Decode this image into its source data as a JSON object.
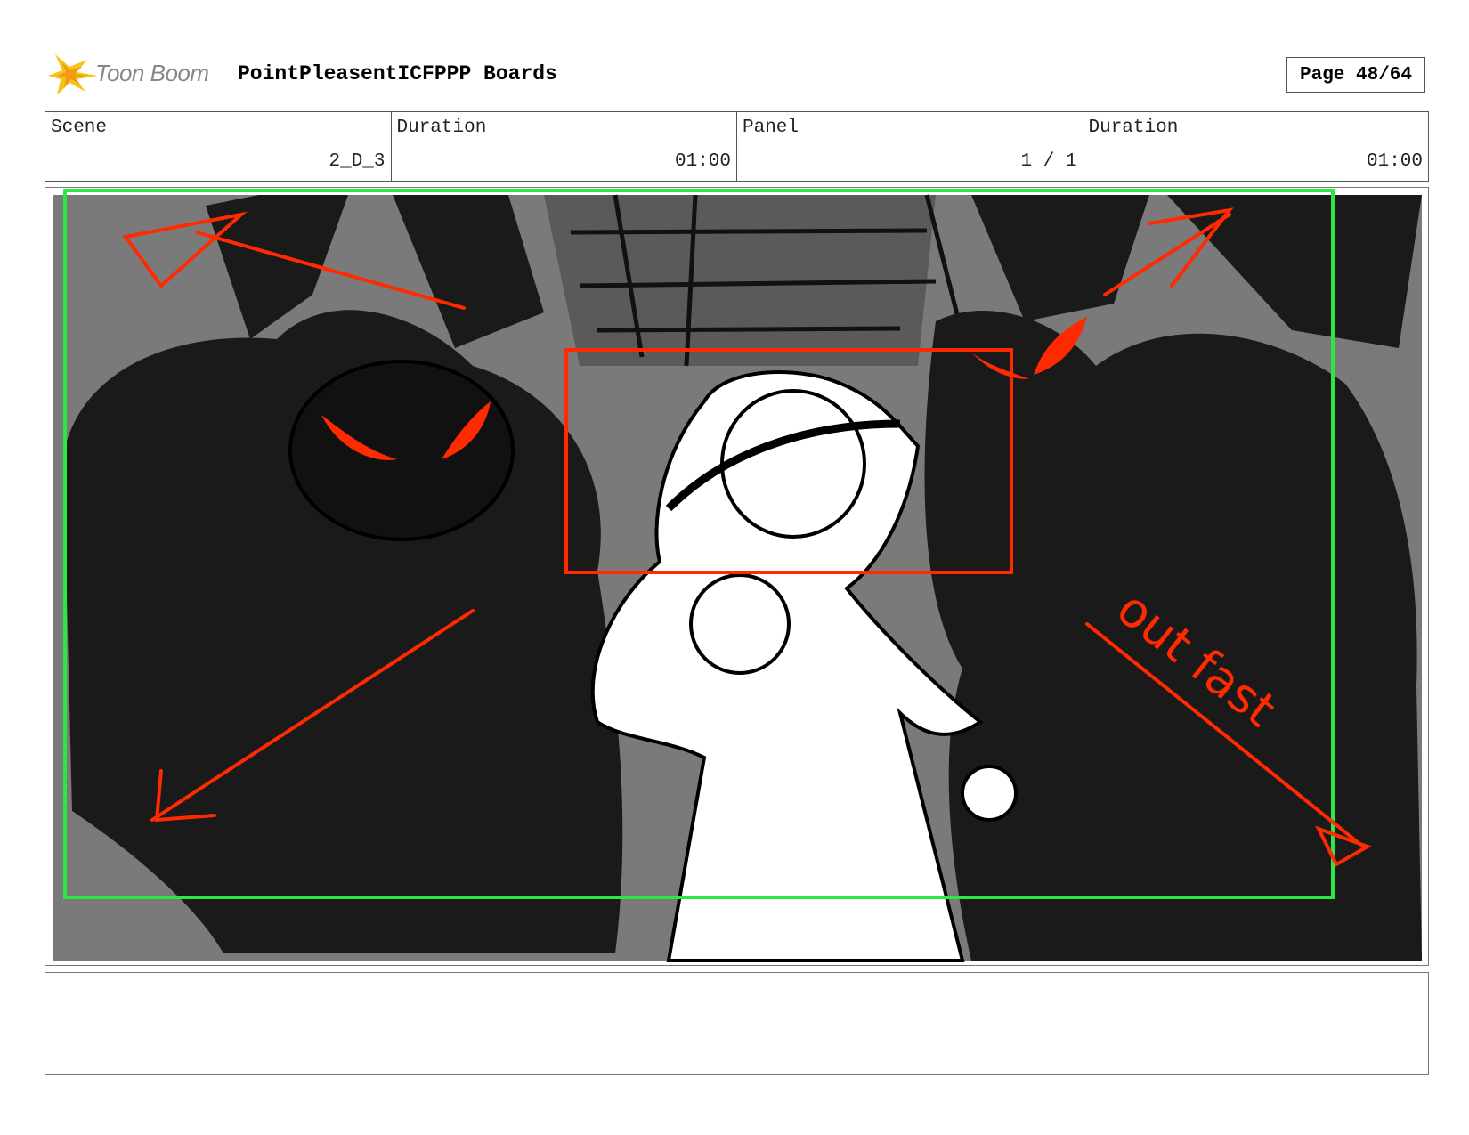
{
  "header": {
    "logo_text": "Toon Boom",
    "board_title": "PointPleasentICFPPP Boards",
    "page_label": "Page 48/64"
  },
  "info": {
    "scene_label": "Scene",
    "scene_value": "2_D_3",
    "scene_duration_label": "Duration",
    "scene_duration_value": "01:00",
    "panel_label": "Panel",
    "panel_value": "1 / 1",
    "panel_duration_label": "Duration",
    "panel_duration_value": "01:00"
  },
  "panel": {
    "annotation": "out fast"
  },
  "notes": {
    "text": ""
  },
  "colors": {
    "safe_frame": "#2ee64a",
    "annotation_red": "#ff2a00",
    "shadow": "#1a1a1a",
    "background_gray": "#7a7a7a"
  }
}
